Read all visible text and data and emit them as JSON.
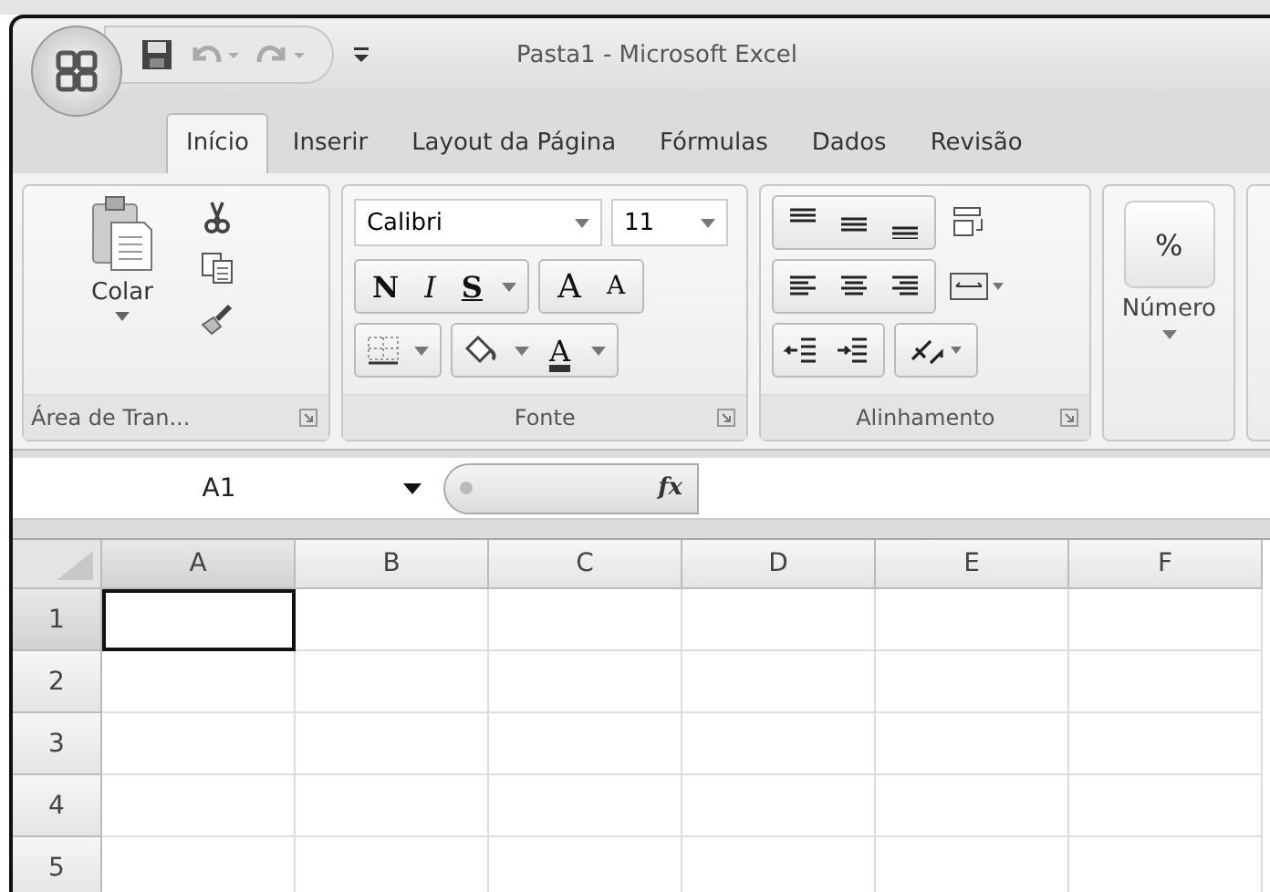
{
  "window": {
    "title": "Pasta1 - Microsoft Excel"
  },
  "tabs": [
    {
      "label": "Início",
      "selected": true
    },
    {
      "label": "Inserir",
      "selected": false
    },
    {
      "label": "Layout da Página",
      "selected": false
    },
    {
      "label": "Fórmulas",
      "selected": false
    },
    {
      "label": "Dados",
      "selected": false
    },
    {
      "label": "Revisão",
      "selected": false
    }
  ],
  "clipboard": {
    "paste_label": "Colar",
    "group_label": "Área de Tran..."
  },
  "font": {
    "name": "Calibri",
    "size": "11",
    "bold_key": "N",
    "italic_key": "I",
    "underline_key": "S",
    "grow_key": "A",
    "shrink_key": "A",
    "color_key": "A",
    "group_label": "Fonte"
  },
  "alignment": {
    "group_label": "Alinhamento"
  },
  "number": {
    "symbol": "%",
    "label": "Número"
  },
  "formula_bar": {
    "name_box": "A1",
    "function_label": "fx"
  },
  "sheet": {
    "columns": [
      {
        "label": "A",
        "selected": true
      },
      {
        "label": "B",
        "selected": false
      },
      {
        "label": "C",
        "selected": false
      },
      {
        "label": "D",
        "selected": false
      },
      {
        "label": "E",
        "selected": false
      },
      {
        "label": "F",
        "selected": false
      }
    ],
    "rows": [
      {
        "label": "1",
        "selected": true
      },
      {
        "label": "2",
        "selected": false
      },
      {
        "label": "3",
        "selected": false
      },
      {
        "label": "4",
        "selected": false
      },
      {
        "label": "5",
        "selected": false
      }
    ]
  }
}
